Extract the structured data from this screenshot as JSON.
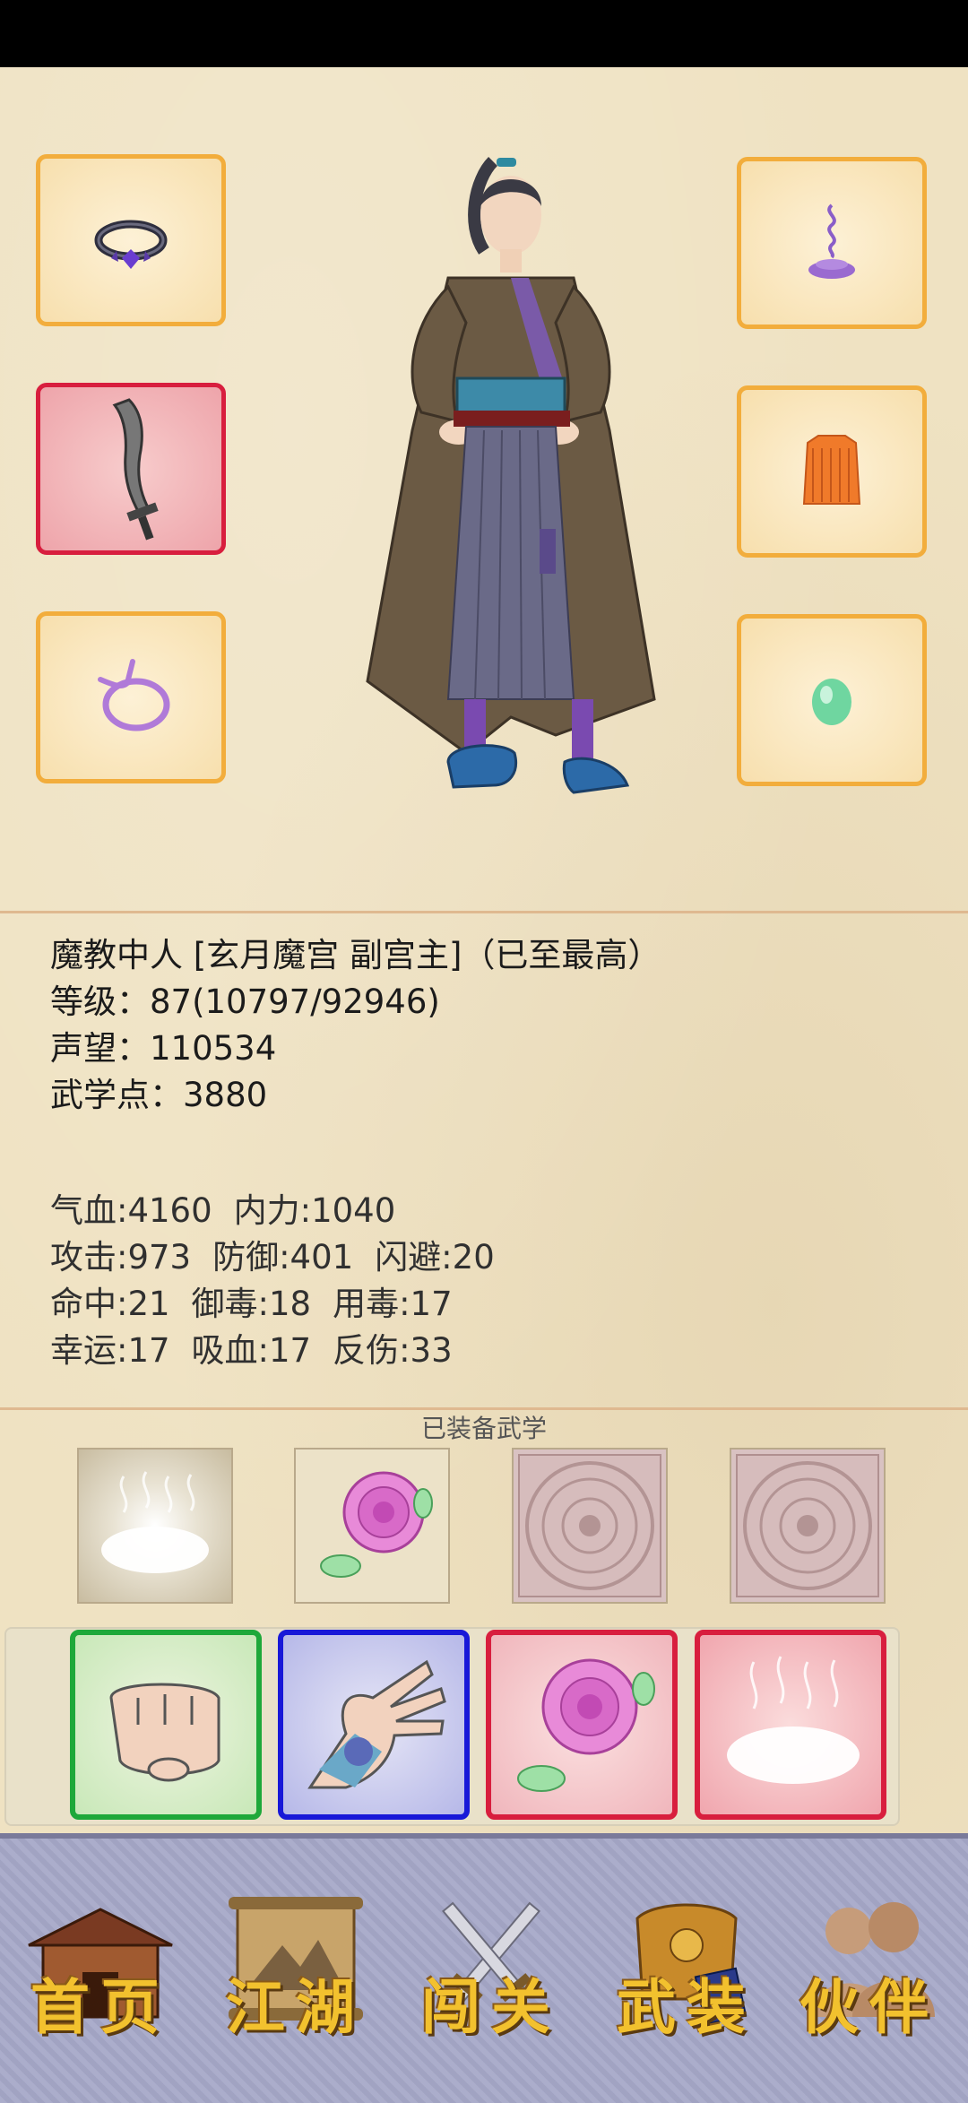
{
  "character": {
    "title_line": "魔教中人 [玄月魔宫 副宫主]（已至最高）",
    "level_line": "等级：87(10797/92946)",
    "prestige_line": "声望：110534",
    "martial_points_line": "武学点：3880"
  },
  "stats": {
    "row1": [
      "气血:4160",
      "内力:1040"
    ],
    "row2": [
      "攻击:973",
      "防御:401",
      "闪避:20"
    ],
    "row3": [
      "命中:21",
      "御毒:18",
      "用毒:17"
    ],
    "row4": [
      "幸运:17",
      "吸血:17",
      "反伤:33"
    ]
  },
  "equipped_martial_arts_title": "已装备武学",
  "equipment_slots": {
    "left": [
      "ring",
      "weapon",
      "amulet"
    ],
    "right": [
      "incense",
      "armor",
      "jade"
    ]
  },
  "colors": {
    "slot_border": "#f2ad3c",
    "slot_border_selected": "#d81e3e",
    "skill_green": "#1ea83a",
    "skill_blue": "#1818d8",
    "skill_red": "#d81e3e",
    "nav_bg": "#a6a8c8",
    "nav_text": "#f2c12e"
  },
  "nav": {
    "home": "首页",
    "jianghu": "江湖",
    "chuangguan": "闯关",
    "wuzhuang": "武装",
    "huoban": "伙伴"
  }
}
